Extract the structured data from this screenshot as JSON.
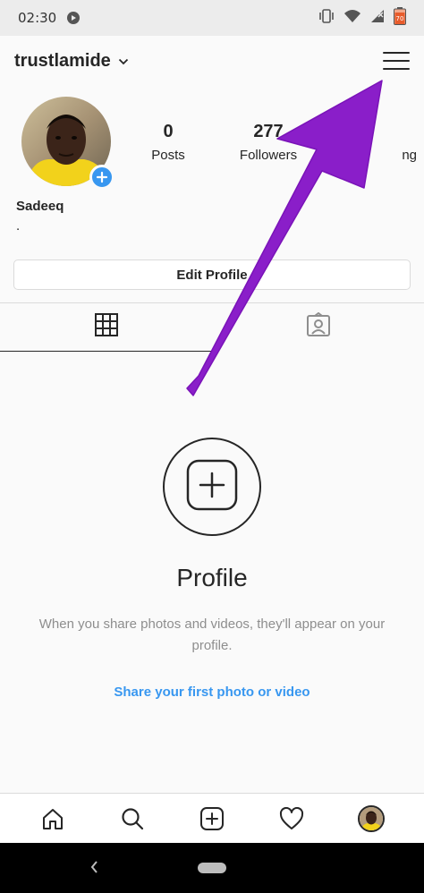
{
  "status_bar": {
    "time": "02:30",
    "battery_text": "70"
  },
  "header": {
    "username": "trustlamide"
  },
  "profile": {
    "display_name": "Sadeeq",
    "bio": ".",
    "stats": [
      {
        "value": "0",
        "label": "Posts"
      },
      {
        "value": "277",
        "label": "Followers"
      },
      {
        "value": "",
        "label": "ng"
      }
    ],
    "edit_button": "Edit Profile"
  },
  "tabs": [
    {
      "icon": "grid-icon",
      "active": true
    },
    {
      "icon": "tagged-icon",
      "active": false
    }
  ],
  "empty_state": {
    "title": "Profile",
    "text": "When you share photos and videos, they'll appear on your profile.",
    "link": "Share your first photo or video"
  },
  "bottom_nav": [
    "home-icon",
    "search-icon",
    "add-post-icon",
    "activity-icon",
    "profile-avatar"
  ],
  "colors": {
    "accent": "#3897f0",
    "annotation": "#8a1ec9",
    "text": "#262626",
    "muted": "#8e8e8e"
  }
}
